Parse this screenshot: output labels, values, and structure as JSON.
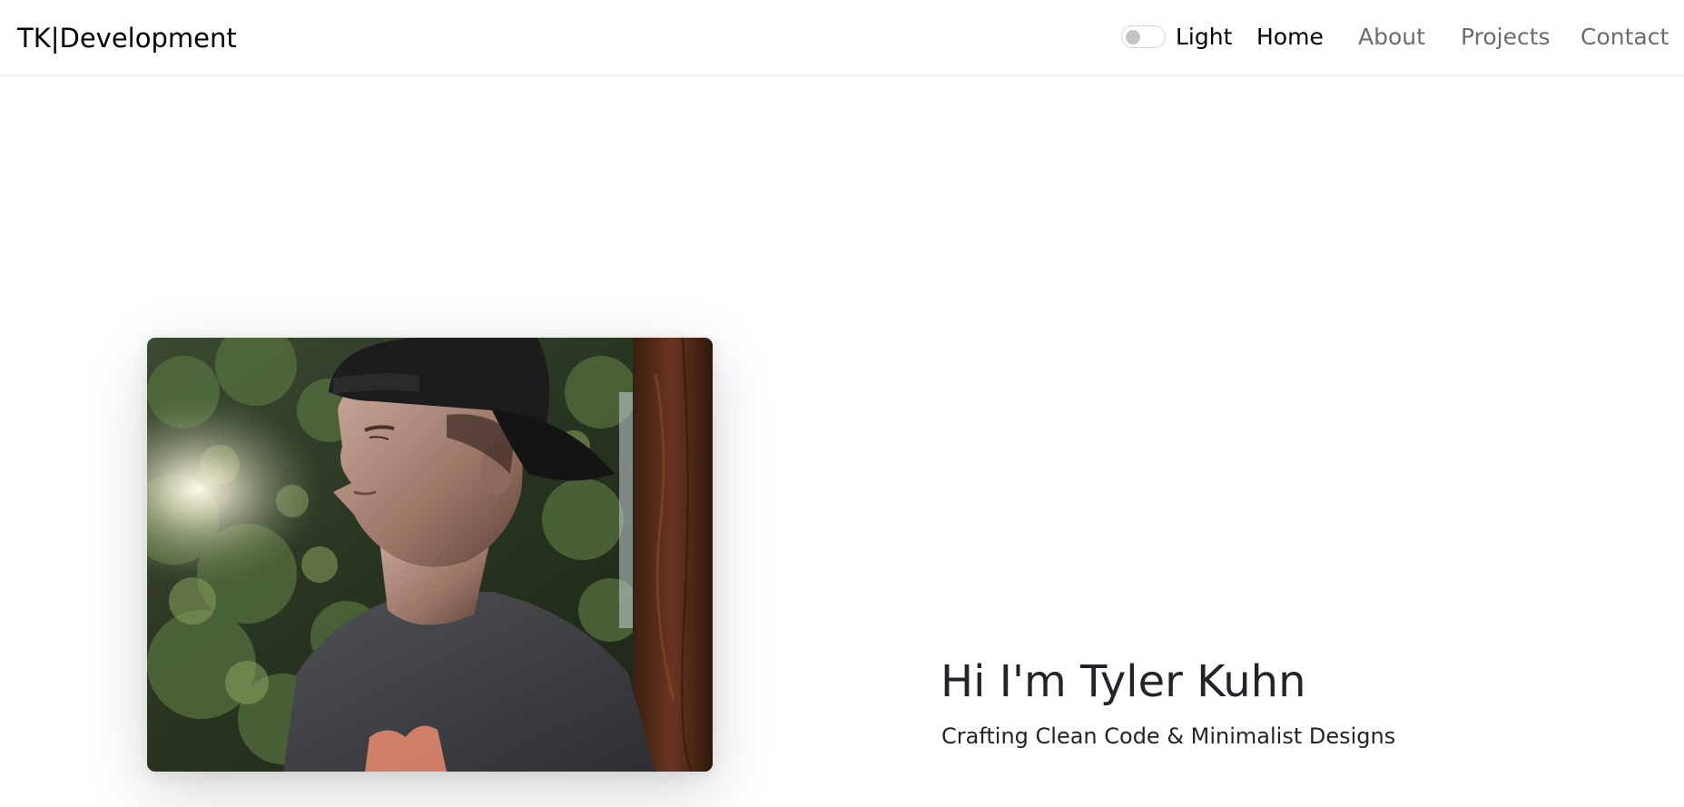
{
  "navbar": {
    "brand": "TK|Development",
    "theme_toggle": {
      "label": "Light",
      "checked": false
    },
    "links": [
      {
        "label": "Home",
        "active": true
      },
      {
        "label": "About",
        "active": false
      },
      {
        "label": "Projects",
        "active": false
      },
      {
        "label": "Contact",
        "active": false
      }
    ]
  },
  "hero": {
    "title": "Hi I'm Tyler Kuhn",
    "subtitle": "Crafting Clean Code & Minimalist Designs",
    "photo": {
      "icon": "profile-photo"
    }
  },
  "colors": {
    "text_primary": "#212529",
    "nav_muted": "#6c6c6c",
    "navbar_border": "#dee2e6",
    "background": "#ffffff"
  }
}
